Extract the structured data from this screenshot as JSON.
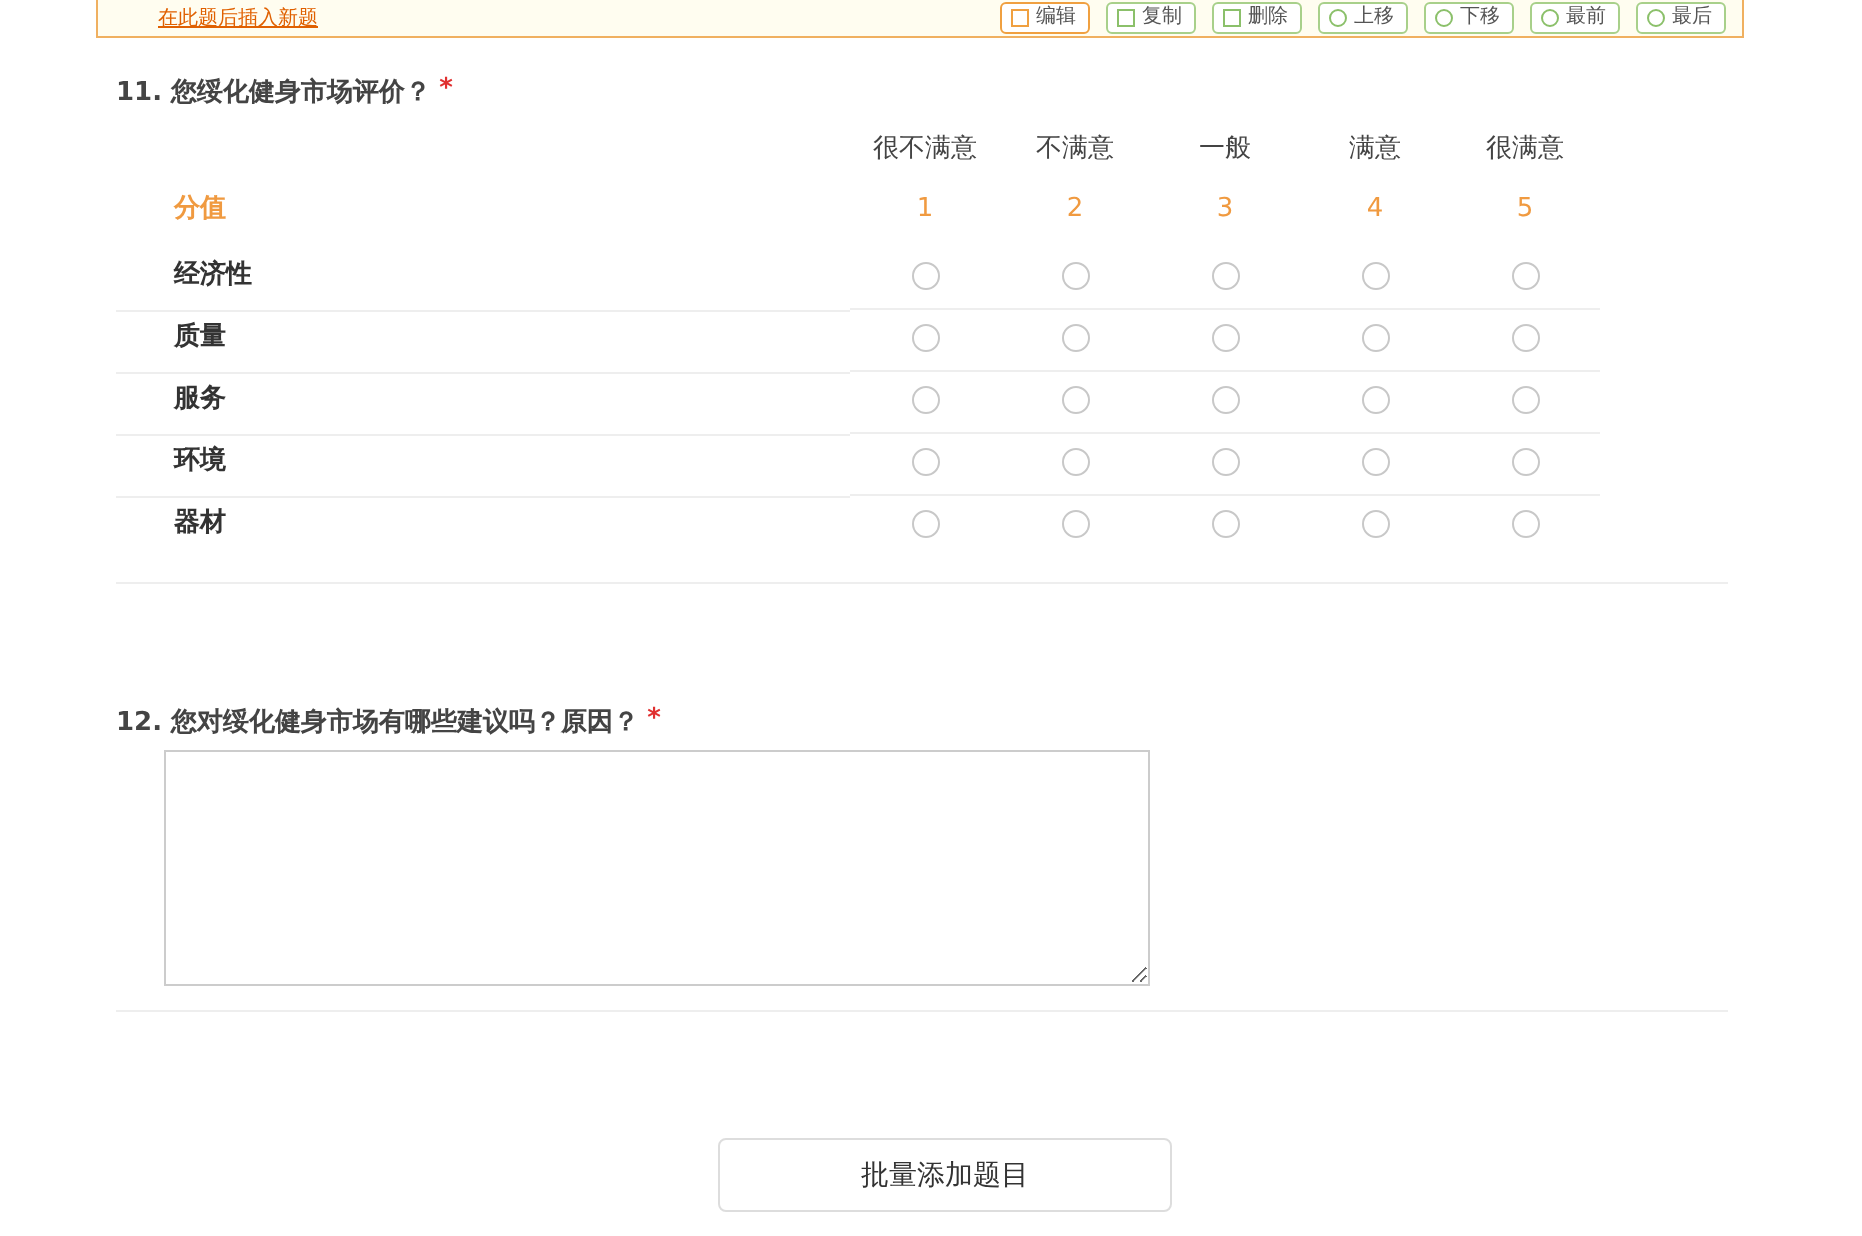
{
  "toolbar": {
    "link": "在此题后插入新题",
    "buttons": [
      {
        "label": "编辑",
        "kind": "edit",
        "selected": true
      },
      {
        "label": "复制",
        "kind": "copy",
        "selected": false
      },
      {
        "label": "删除",
        "kind": "delete",
        "selected": false
      },
      {
        "label": "上移",
        "kind": "up",
        "selected": false
      },
      {
        "label": "下移",
        "kind": "down",
        "selected": false
      },
      {
        "label": "最前",
        "kind": "first",
        "selected": false
      },
      {
        "label": "最后",
        "kind": "last",
        "selected": false
      }
    ]
  },
  "q11": {
    "number": "11.",
    "title": "您绥化健身市场评价？",
    "required": "*",
    "columns": [
      "很不满意",
      "不满意",
      "一般",
      "满意",
      "很满意"
    ],
    "score_label": "分值",
    "scores": [
      "1",
      "2",
      "3",
      "4",
      "5"
    ],
    "rows": [
      {
        "label": "经济性",
        "choices": [
          false,
          false,
          false,
          false,
          false
        ]
      },
      {
        "label": "质量",
        "choices": [
          false,
          false,
          false,
          false,
          false
        ]
      },
      {
        "label": "服务",
        "choices": [
          false,
          false,
          false,
          false,
          false
        ]
      },
      {
        "label": "环境",
        "choices": [
          false,
          false,
          false,
          false,
          false
        ]
      },
      {
        "label": "器材",
        "choices": [
          false,
          false,
          false,
          false,
          false
        ]
      }
    ]
  },
  "q12": {
    "number": "12.",
    "title": "您对绥化健身市场有哪些建议吗？原因？",
    "required": "*"
  },
  "batch_button": "批量添加题目"
}
